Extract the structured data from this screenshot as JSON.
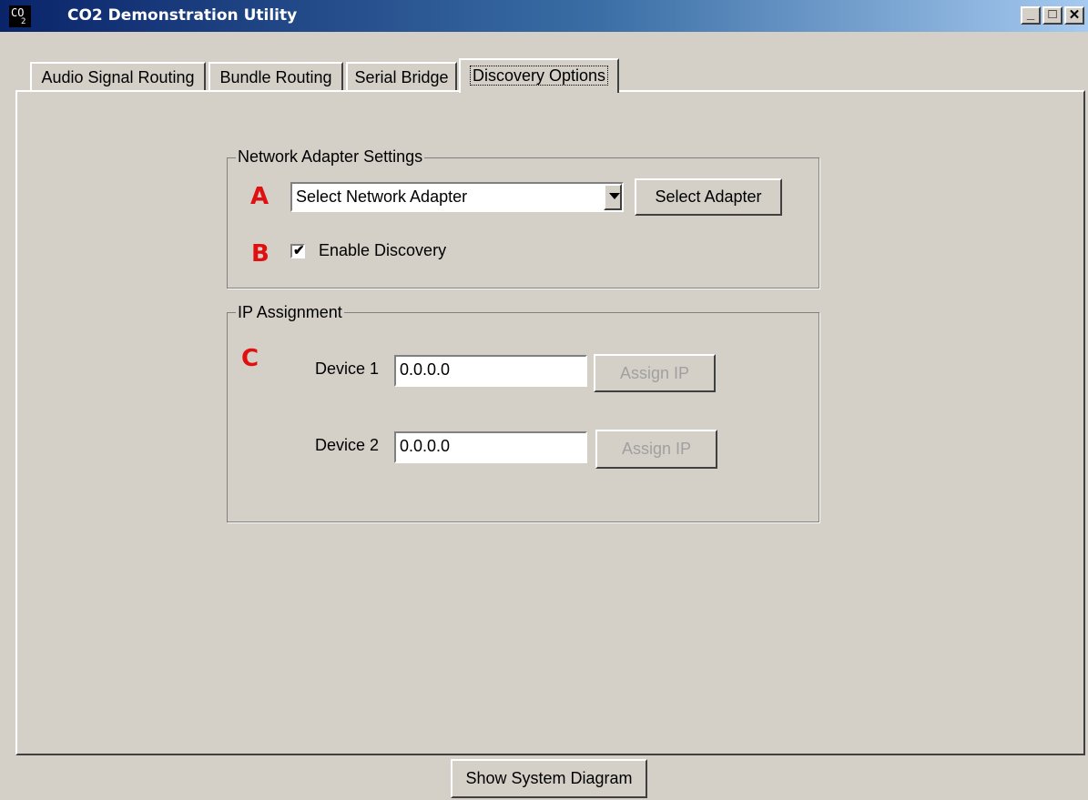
{
  "window": {
    "title": "CO2 Demonstration Utility",
    "icon_text": "CO",
    "icon_subscript": "2",
    "controls": {
      "minimize": "_",
      "maximize": "□",
      "close": "✕"
    }
  },
  "tabs": [
    {
      "label": "Audio Signal Routing"
    },
    {
      "label": "Bundle Routing"
    },
    {
      "label": "Serial Bridge"
    },
    {
      "label": "Discovery Options"
    }
  ],
  "network_adapter": {
    "group_title": "Network Adapter Settings",
    "marker_a": "A",
    "marker_b": "B",
    "dropdown_value": "Select Network Adapter",
    "select_button": "Select Adapter",
    "discovery_label": "Enable Discovery",
    "discovery_checked": true
  },
  "ip_assignment": {
    "group_title": "IP Assignment",
    "marker_c": "C",
    "devices": [
      {
        "label": "Device 1",
        "value": "0.0.0.0",
        "button": "Assign IP"
      },
      {
        "label": "Device 2",
        "value": "0.0.0.0",
        "button": "Assign IP"
      }
    ]
  },
  "footer": {
    "show_diagram_button": "Show System Diagram"
  },
  "colors": {
    "marker": "#e01010",
    "titlebar_start": "#0a246a",
    "titlebar_end": "#a6caf0",
    "face": "#d4d0c8"
  }
}
